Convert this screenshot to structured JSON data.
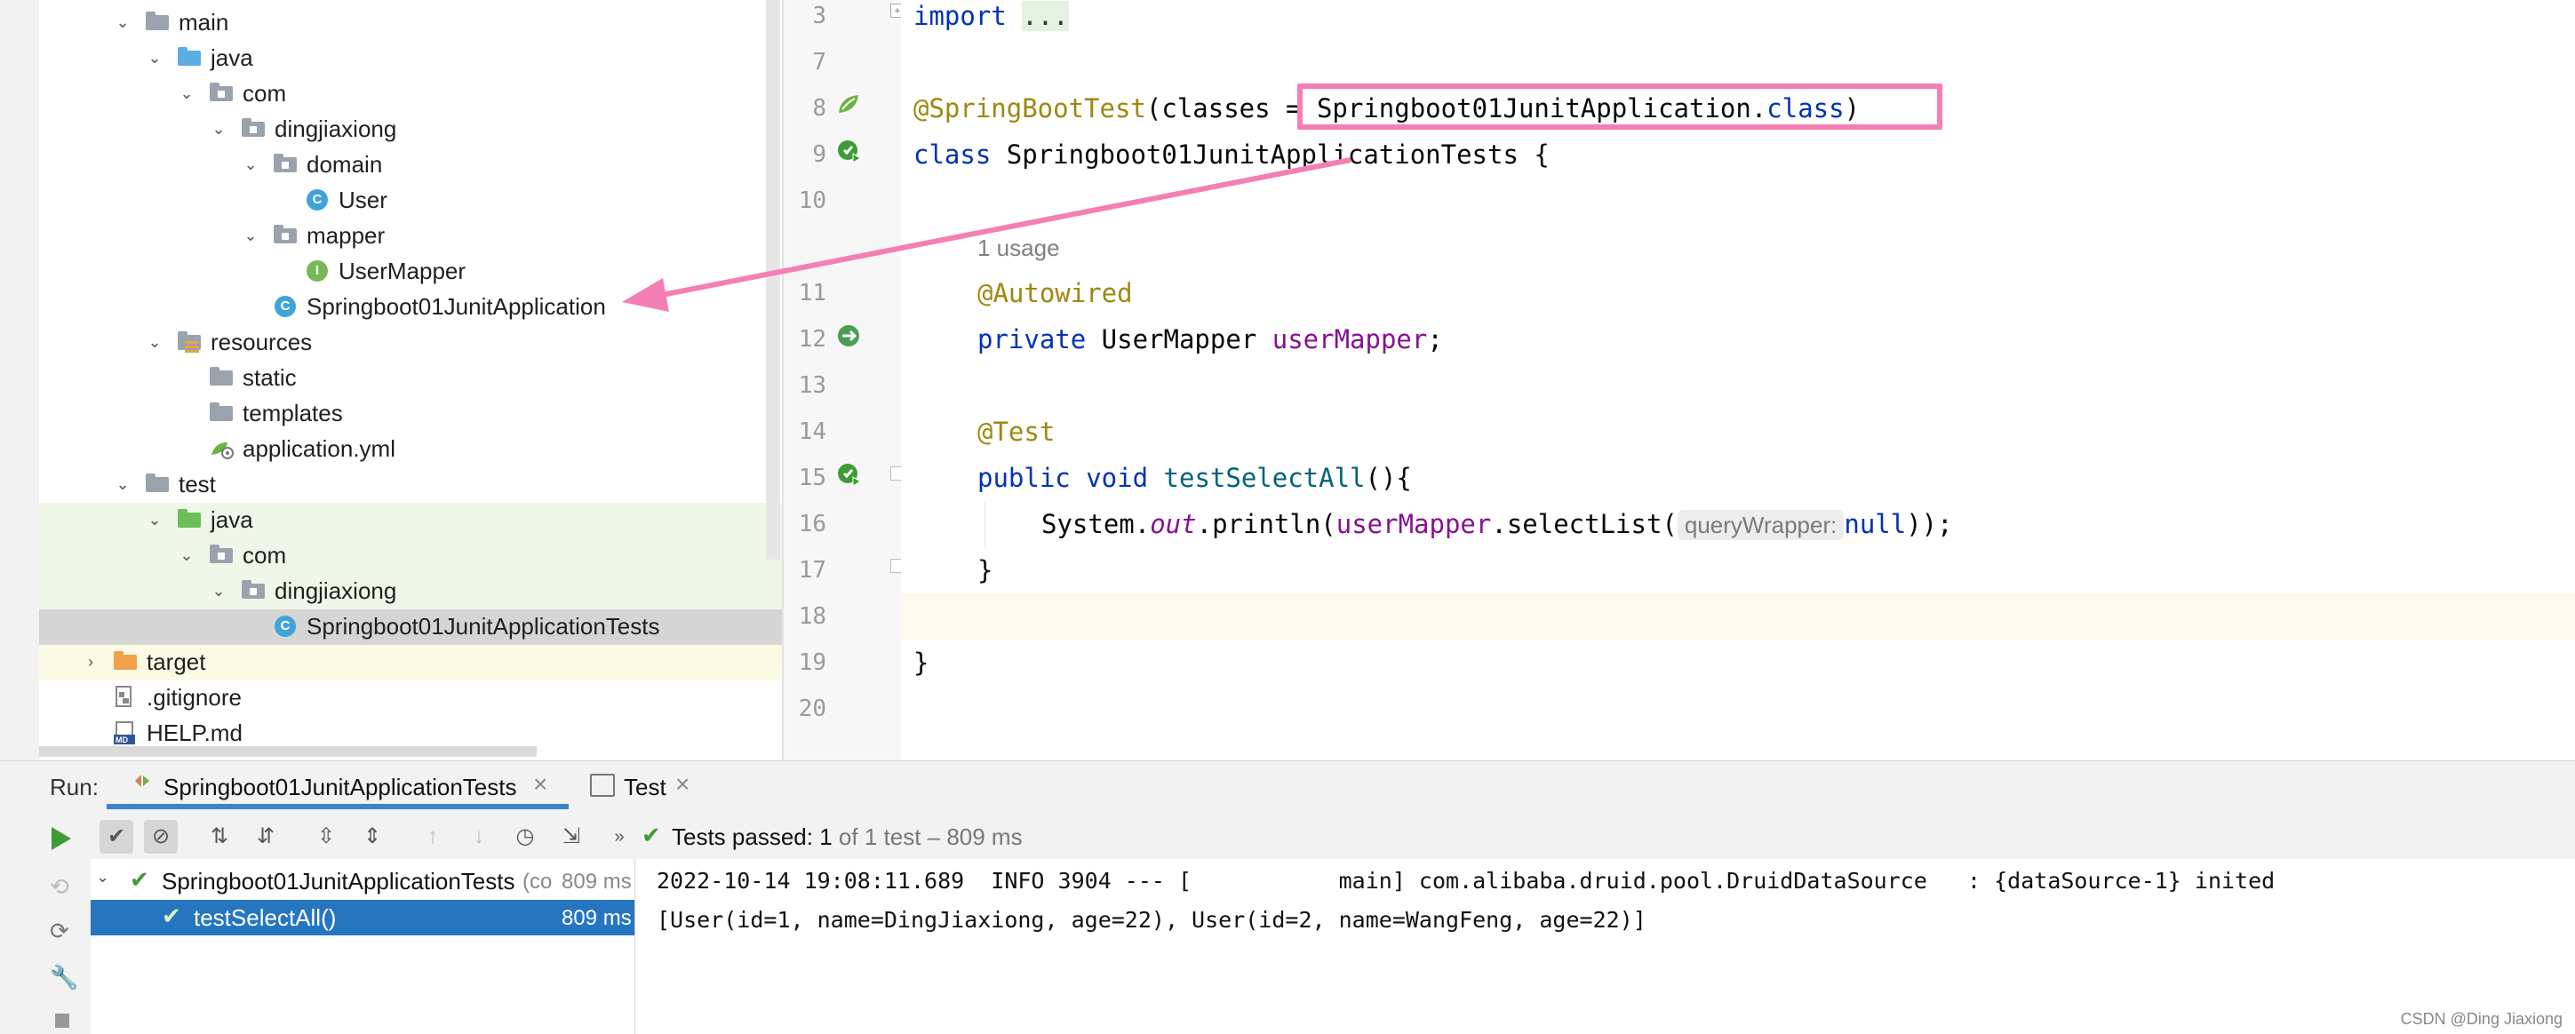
{
  "project_tree": [
    {
      "label": "main",
      "icon": "folder-icon"
    },
    {
      "label": "java",
      "icon": "source-folder-icon"
    },
    {
      "label": "com",
      "icon": "package-icon"
    },
    {
      "label": "dingjiaxiong",
      "icon": "package-icon"
    },
    {
      "label": "domain",
      "icon": "package-icon"
    },
    {
      "label": "User",
      "icon": "class-icon"
    },
    {
      "label": "mapper",
      "icon": "package-icon"
    },
    {
      "label": "UserMapper",
      "icon": "interface-icon"
    },
    {
      "label": "Springboot01JunitApplication",
      "icon": "spring-boot-class-icon"
    },
    {
      "label": "resources",
      "icon": "resources-folder-icon"
    },
    {
      "label": "static",
      "icon": "folder-icon"
    },
    {
      "label": "templates",
      "icon": "folder-icon"
    },
    {
      "label": "application.yml",
      "icon": "yaml-file-icon"
    },
    {
      "label": "test",
      "icon": "folder-icon"
    },
    {
      "label": "java",
      "icon": "test-source-folder-icon"
    },
    {
      "label": "com",
      "icon": "package-icon"
    },
    {
      "label": "dingjiaxiong",
      "icon": "package-icon"
    },
    {
      "label": "Springboot01JunitApplicationTests",
      "icon": "test-class-icon"
    },
    {
      "label": "target",
      "icon": "excluded-folder-icon"
    },
    {
      "label": ".gitignore",
      "icon": "gitignore-file-icon"
    },
    {
      "label": "HELP.md",
      "icon": "markdown-file-icon"
    }
  ],
  "editor": {
    "line_numbers": [
      "3",
      "7",
      "8",
      "9",
      "10",
      "11",
      "12",
      "13",
      "14",
      "15",
      "16",
      "17",
      "18",
      "19",
      "20"
    ],
    "usage_hint": "1 usage",
    "code": {
      "l3_kw": "import",
      "l3_fold": "...",
      "l8_ann": "@SpringBootTest",
      "l8_open": "(classes ",
      "l8_eq": "= ",
      "l8_cls": "Springboot01JunitApplication.",
      "l8_classkw": "class",
      "l8_close": ")",
      "l9_kw": "class",
      "l9_name": " Springboot01JunitApplicationTests {",
      "l11_ann": "@Autowired",
      "l12_kw": "private",
      "l12_type": " UserMapper ",
      "l12_field": "userMapper",
      "l12_semi": ";",
      "l14_ann": "@Test",
      "l15_kw": "public void",
      "l15_method": "testSelectAll",
      "l15_rest": "(){",
      "l16_sys": "System.",
      "l16_out": "out",
      "l16_println": ".println(",
      "l16_field": "userMapper",
      "l16_call": ".selectList(",
      "l16_hint": "queryWrapper:",
      "l16_null": "null",
      "l16_end": "));",
      "l17": "}",
      "l19": "}"
    }
  },
  "run_panel": {
    "run_label": "Run:",
    "tabs": [
      {
        "label": "Springboot01JunitApplicationTests"
      },
      {
        "label": "Test"
      }
    ],
    "status_prefix": "Tests passed:",
    "status_count": "1",
    "status_suffix": "of 1 test – 809 ms",
    "results": [
      {
        "label": "Springboot01JunitApplicationTests",
        "clip": "(co",
        "time": "809 ms"
      },
      {
        "label": "testSelectAll()",
        "time": "809 ms"
      }
    ],
    "console_lines": [
      "2022-10-14 19:08:11.689  INFO 3904 --- [           main] com.alibaba.druid.pool.DruidDataSource   : {dataSource-1} inited",
      "[User(id=1, name=DingJiaxiong, age=22), User(id=2, name=WangFeng, age=22)]"
    ]
  },
  "watermark": "CSDN @Ding Jiaxiong",
  "colors": {
    "annotation_highlight": "#f47fb4",
    "selection": "#2675bf",
    "test_pass": "#3f9c35"
  }
}
